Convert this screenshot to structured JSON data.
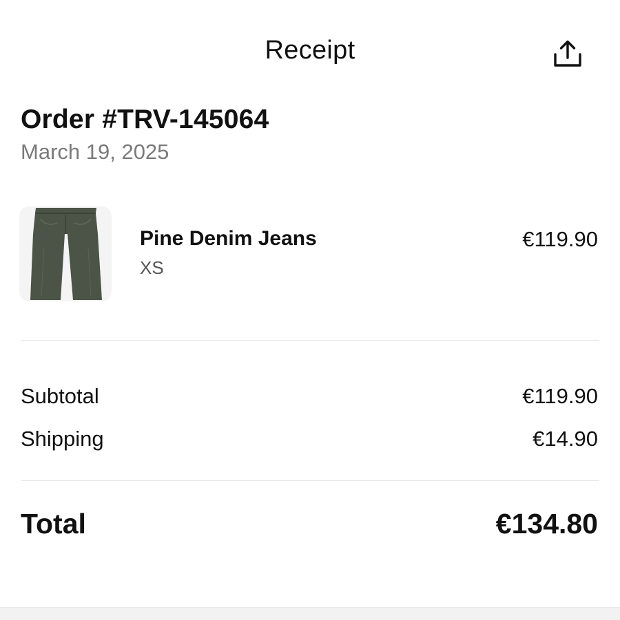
{
  "header": {
    "title": "Receipt",
    "share_icon": "share-icon"
  },
  "order": {
    "title": "Order #TRV-145064",
    "date": "March 19, 2025"
  },
  "items": [
    {
      "name": "Pine Denim Jeans",
      "variant": "XS",
      "price": "€119.90",
      "thumbnail_icon": "jeans-image",
      "thumbnail_color": "#4b5446"
    }
  ],
  "summary": {
    "subtotal_label": "Subtotal",
    "subtotal_value": "€119.90",
    "shipping_label": "Shipping",
    "shipping_value": "€14.90"
  },
  "total": {
    "label": "Total",
    "value": "€134.80"
  },
  "colors": {
    "text": "#111111",
    "muted": "#7a7a7a",
    "divider": "#e6e6e6"
  }
}
